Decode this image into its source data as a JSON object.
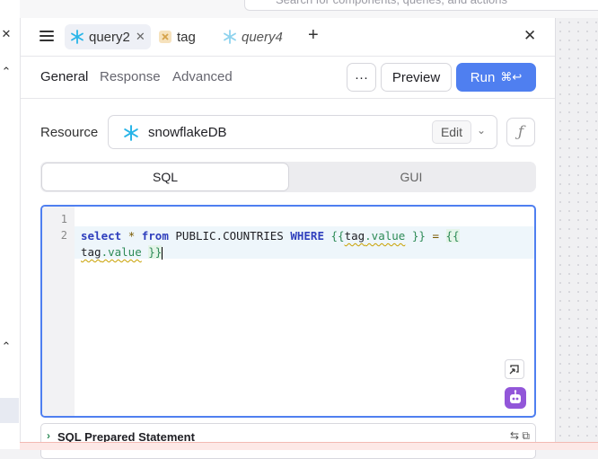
{
  "top": {
    "search_placeholder": "Search for components, queries, and actions"
  },
  "tabs": [
    {
      "label": "query2",
      "icon": "snowflake-icon",
      "active": true,
      "closable": true
    },
    {
      "label": "tag",
      "icon": "tag-component-icon",
      "active": false
    },
    {
      "label": "query4",
      "icon": "snowflake-icon",
      "active": false,
      "preview": true
    }
  ],
  "subnav": {
    "tabs": [
      "General",
      "Response",
      "Advanced"
    ],
    "active": "General",
    "more_label": "···",
    "preview_label": "Preview",
    "run_label": "Run",
    "run_shortcut": "⌘↩"
  },
  "resource": {
    "label": "Resource",
    "name": "snowflakeDB",
    "edit_label": "Edit",
    "fx_label": "ƒ"
  },
  "mode_toggle": {
    "options": [
      "SQL",
      "GUI"
    ],
    "active": "SQL"
  },
  "editor": {
    "line_numbers": [
      "1",
      "2"
    ],
    "line2": {
      "kw_select": "select",
      "star": "*",
      "kw_from": "from",
      "table": "PUBLIC.COUNTRIES",
      "kw_where": "WHERE",
      "open1": "{{",
      "var1_obj": "tag",
      "var1_prop": ".value",
      "close1": "}}",
      "eq": "=",
      "open2": "{{",
      "var2_obj": "tag",
      "var2_prop": ".value",
      "close2": "}}"
    }
  },
  "prepared_statement": {
    "label": "SQL Prepared Statement"
  },
  "colors": {
    "accent": "#4f7ff0",
    "snowflake": "#29b5e8",
    "ai": "#9256d9"
  }
}
